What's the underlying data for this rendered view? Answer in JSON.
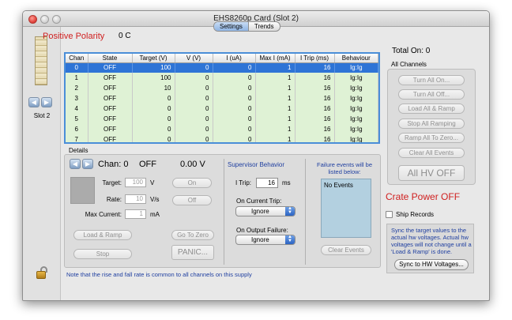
{
  "window": {
    "title": "EHS8260p Card (Slot 2)"
  },
  "sidebar": {
    "slot_label": "Slot 2",
    "prev_arrow": "◀",
    "next_arrow": "▶"
  },
  "tabs": [
    {
      "label": "Settings",
      "active": true
    },
    {
      "label": "Trends",
      "active": false
    }
  ],
  "polarity": {
    "title": "Positive Polarity",
    "temperature": "0 C"
  },
  "table": {
    "columns": [
      "Chan",
      "State",
      "Target (V)",
      "V (V)",
      "I (uA)",
      "Max I (mA)",
      "I Trip (ms)",
      "Behaviour"
    ],
    "rows": [
      [
        "0",
        "OFF",
        "100",
        "0",
        "0",
        "1",
        "16",
        "Ig:Ig"
      ],
      [
        "1",
        "OFF",
        "100",
        "0",
        "0",
        "1",
        "16",
        "Ig:Ig"
      ],
      [
        "2",
        "OFF",
        "10",
        "0",
        "0",
        "1",
        "16",
        "Ig:Ig"
      ],
      [
        "3",
        "OFF",
        "0",
        "0",
        "0",
        "1",
        "16",
        "Ig:Ig"
      ],
      [
        "4",
        "OFF",
        "0",
        "0",
        "0",
        "1",
        "16",
        "Ig:Ig"
      ],
      [
        "5",
        "OFF",
        "0",
        "0",
        "0",
        "1",
        "16",
        "Ig:Ig"
      ],
      [
        "6",
        "OFF",
        "0",
        "0",
        "0",
        "1",
        "16",
        "Ig:Ig"
      ],
      [
        "7",
        "OFF",
        "0",
        "0",
        "0",
        "1",
        "16",
        "Ig:Ig"
      ]
    ],
    "selected_row": 0
  },
  "all_channels": {
    "total_on": "Total On: 0",
    "label": "All Channels",
    "buttons": [
      "Turn All On...",
      "Turn All Off...",
      "Load All & Ramp",
      "Stop All Ramping",
      "Ramp All To Zero...",
      "Clear All Events"
    ],
    "hv_off": "All HV OFF"
  },
  "crate_power": "Crate Power OFF",
  "ship_records": "Ship Records",
  "sync": {
    "text": "Sync the target values to the actual hw voltages. Actual hw voltages will not change until a 'Load & Ramp' is done.",
    "button": "Sync to HW Voltages..."
  },
  "details": {
    "label": "Details",
    "chan": "Chan: 0",
    "state": "OFF",
    "voltage": "0.00 V",
    "target_label": "Target:",
    "target_value": "100",
    "target_unit": "V",
    "rate_label": "Rate:",
    "rate_value": "10",
    "rate_unit": "V/s",
    "maxcur_label": "Max Current:",
    "maxcur_value": "1",
    "maxcur_unit": "mA",
    "on_button": "On",
    "off_button": "Off",
    "load_ramp": "Load & Ramp",
    "stop": "Stop",
    "go_to_zero": "Go To Zero",
    "panic": "PANIC...",
    "note": "Note that the rise and fall rate is common to all channels on this supply"
  },
  "supervisor": {
    "title": "Supervisor Behavior",
    "itrip_label": "I Trip:",
    "itrip_value": "16",
    "itrip_unit": "ms",
    "on_current_trip_label": "On Current Trip:",
    "on_current_trip_value": "Ignore",
    "on_output_failure_label": "On Output Failure:",
    "on_output_failure_value": "Ignore"
  },
  "failure": {
    "title": "Failure events will be listed below:",
    "events_text": "No Events",
    "clear_button": "Clear Events"
  }
}
